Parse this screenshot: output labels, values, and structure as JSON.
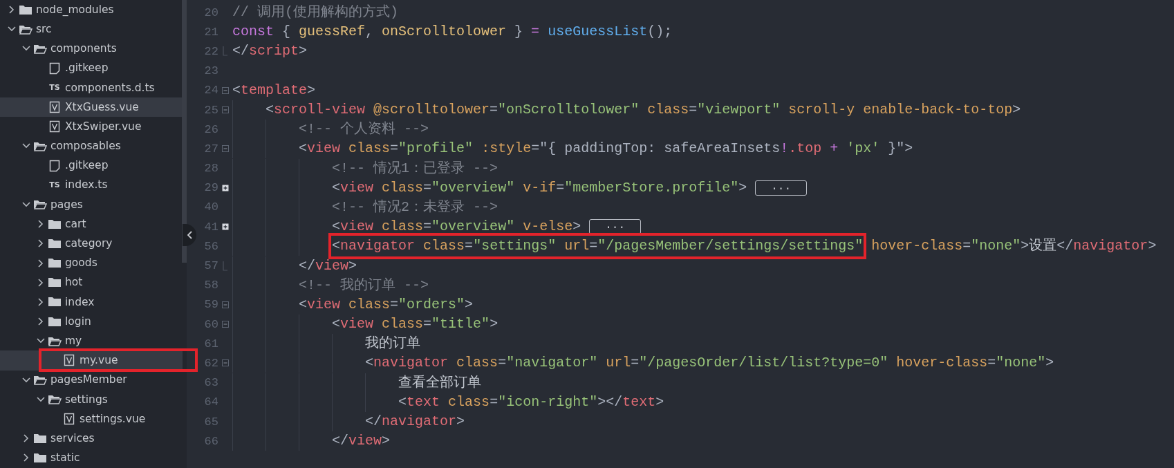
{
  "explorer": {
    "items": [
      {
        "kind": "folder",
        "name": "node_modules",
        "expanded": false,
        "selected": false
      },
      {
        "kind": "folder",
        "name": "src",
        "expanded": true,
        "selected": false,
        "children": [
          {
            "kind": "folder",
            "name": "components",
            "expanded": true,
            "selected": false,
            "children": [
              {
                "kind": "file",
                "name": ".gitkeep",
                "selected": false
              },
              {
                "kind": "ts",
                "badge": "TS",
                "name": "components.d.ts",
                "selected": false
              },
              {
                "kind": "vue",
                "name": "XtxGuess.vue",
                "selected": true
              },
              {
                "kind": "vue",
                "name": "XtxSwiper.vue",
                "selected": false
              }
            ]
          },
          {
            "kind": "folder",
            "name": "composables",
            "expanded": true,
            "selected": false,
            "children": [
              {
                "kind": "file",
                "name": ".gitkeep",
                "selected": false
              },
              {
                "kind": "ts",
                "badge": "TS",
                "name": "index.ts",
                "selected": false
              }
            ]
          },
          {
            "kind": "folder",
            "name": "pages",
            "expanded": true,
            "selected": false,
            "children": [
              {
                "kind": "folder",
                "name": "cart",
                "expanded": false,
                "selected": false
              },
              {
                "kind": "folder",
                "name": "category",
                "expanded": false,
                "selected": false
              },
              {
                "kind": "folder",
                "name": "goods",
                "expanded": false,
                "selected": false
              },
              {
                "kind": "folder",
                "name": "hot",
                "expanded": false,
                "selected": false
              },
              {
                "kind": "folder",
                "name": "index",
                "expanded": false,
                "selected": false
              },
              {
                "kind": "folder",
                "name": "login",
                "expanded": false,
                "selected": false
              },
              {
                "kind": "folder",
                "name": "my",
                "expanded": true,
                "selected": false,
                "children": [
                  {
                    "kind": "vue",
                    "name": "my.vue",
                    "selected": true,
                    "annotated": true
                  }
                ]
              }
            ]
          },
          {
            "kind": "folder",
            "name": "pagesMember",
            "expanded": true,
            "selected": false,
            "children": [
              {
                "kind": "folder",
                "name": "settings",
                "expanded": true,
                "selected": false,
                "children": [
                  {
                    "kind": "vue",
                    "name": "settings.vue",
                    "selected": false
                  }
                ]
              }
            ]
          },
          {
            "kind": "folder",
            "name": "services",
            "expanded": false,
            "selected": false
          },
          {
            "kind": "folder",
            "name": "static",
            "expanded": false,
            "selected": false
          }
        ]
      }
    ]
  },
  "editor": {
    "lines": [
      {
        "number": "20",
        "tokens": [
          {
            "kind": "com",
            "text": "// 调用(使用解构的方式)"
          }
        ]
      },
      {
        "number": "21",
        "tokens": [
          {
            "kind": "kw",
            "text": "const"
          },
          {
            "kind": "p",
            "text": " { "
          },
          {
            "kind": "var",
            "text": "guessRef"
          },
          {
            "kind": "p",
            "text": ", "
          },
          {
            "kind": "var",
            "text": "onScrolltolower"
          },
          {
            "kind": "p",
            "text": " } "
          },
          {
            "kind": "kw",
            "text": "="
          },
          {
            "kind": "fn",
            "text": " useGuessList"
          },
          {
            "kind": "p",
            "text": "();"
          }
        ]
      },
      {
        "number": "22",
        "fold_end": true,
        "tokens": [
          {
            "kind": "p",
            "text": "</"
          },
          {
            "kind": "tag",
            "text": "script"
          },
          {
            "kind": "p",
            "text": ">"
          }
        ]
      },
      {
        "number": "23"
      },
      {
        "number": "24",
        "collapsed": false,
        "tokens": [
          {
            "kind": "p",
            "text": "<"
          },
          {
            "kind": "tag",
            "text": "template"
          },
          {
            "kind": "p",
            "text": ">"
          }
        ]
      },
      {
        "number": "25",
        "collapsed": false,
        "tokens": [
          {
            "kind": "p",
            "text": "    <"
          },
          {
            "kind": "tag",
            "text": "scroll-view"
          },
          {
            "kind": "attr",
            "text": " @scrolltolower"
          },
          {
            "kind": "p",
            "text": "="
          },
          {
            "kind": "str",
            "text": "\"onScrolltolower\""
          },
          {
            "kind": "attr",
            "text": " class"
          },
          {
            "kind": "p",
            "text": "="
          },
          {
            "kind": "str",
            "text": "\"viewport\""
          },
          {
            "kind": "attr",
            "text": " scroll-y"
          },
          {
            "kind": "attr",
            "text": " enable-back-to-top"
          },
          {
            "kind": "p",
            "text": ">"
          }
        ]
      },
      {
        "number": "26",
        "tokens": [
          {
            "kind": "com",
            "text": "        <!-- 个人资料 -->"
          }
        ]
      },
      {
        "number": "27",
        "collapsed": false,
        "tokens": [
          {
            "kind": "p",
            "text": "        <"
          },
          {
            "kind": "tag",
            "text": "view"
          },
          {
            "kind": "attr",
            "text": " class"
          },
          {
            "kind": "p",
            "text": "="
          },
          {
            "kind": "str",
            "text": "\"profile\""
          },
          {
            "kind": "attr",
            "text": " :style"
          },
          {
            "kind": "p",
            "text": "=\"{ paddingTop: safeAreaInsets"
          },
          {
            "kind": "kw",
            "text": "!"
          },
          {
            "kind": "tag",
            "text": ".top"
          },
          {
            "kind": "kw",
            "text": " +"
          },
          {
            "kind": "str",
            "text": " 'px'"
          },
          {
            "kind": "p",
            "text": " }\">"
          }
        ]
      },
      {
        "number": "28",
        "tokens": [
          {
            "kind": "com",
            "text": "            <!-- 情况1：已登录 -->"
          }
        ]
      },
      {
        "number": "29",
        "collapsed": true,
        "fold_box": "...",
        "tokens": [
          {
            "kind": "p",
            "text": "            <"
          },
          {
            "kind": "tag",
            "text": "view"
          },
          {
            "kind": "attr",
            "text": " class"
          },
          {
            "kind": "p",
            "text": "="
          },
          {
            "kind": "str",
            "text": "\"overview\""
          },
          {
            "kind": "attr",
            "text": " v-if"
          },
          {
            "kind": "p",
            "text": "="
          },
          {
            "kind": "str",
            "text": "\"memberStore.profile\""
          },
          {
            "kind": "p",
            "text": ">"
          }
        ]
      },
      {
        "number": "40",
        "tokens": [
          {
            "kind": "com",
            "text": "            <!-- 情况2：未登录 -->"
          }
        ]
      },
      {
        "number": "41",
        "collapsed": true,
        "fold_box": "...",
        "tokens": [
          {
            "kind": "p",
            "text": "            <"
          },
          {
            "kind": "tag",
            "text": "view"
          },
          {
            "kind": "attr",
            "text": " class"
          },
          {
            "kind": "p",
            "text": "="
          },
          {
            "kind": "str",
            "text": "\"overview\""
          },
          {
            "kind": "attr",
            "text": " v-else"
          },
          {
            "kind": "p",
            "text": ">"
          }
        ]
      },
      {
        "number": "56",
        "framed": [
          {
            "kind": "p",
            "text": "            <"
          },
          {
            "kind": "tag",
            "text": "navigator"
          },
          {
            "kind": "attr",
            "text": " class"
          },
          {
            "kind": "p",
            "text": "="
          },
          {
            "kind": "str",
            "text": "\"settings\""
          },
          {
            "kind": "attr",
            "text": " url"
          },
          {
            "kind": "p",
            "text": "="
          },
          {
            "kind": "str",
            "text": "\"/pagesMember/settings/settings\""
          }
        ],
        "tokens": [
          {
            "kind": "attr",
            "text": " hover-class"
          },
          {
            "kind": "p",
            "text": "="
          },
          {
            "kind": "str",
            "text": "\"none\""
          },
          {
            "kind": "p",
            "text": ">"
          },
          {
            "kind": "txt",
            "text": "设置"
          },
          {
            "kind": "p",
            "text": "</"
          },
          {
            "kind": "tag",
            "text": "navigator"
          },
          {
            "kind": "p",
            "text": ">"
          }
        ]
      },
      {
        "number": "57",
        "fold_end": true,
        "tokens": [
          {
            "kind": "p",
            "text": "        </"
          },
          {
            "kind": "tag",
            "text": "view"
          },
          {
            "kind": "p",
            "text": ">"
          }
        ]
      },
      {
        "number": "58",
        "tokens": [
          {
            "kind": "com",
            "text": "        <!-- 我的订单 -->"
          }
        ]
      },
      {
        "number": "59",
        "collapsed": false,
        "tokens": [
          {
            "kind": "p",
            "text": "        <"
          },
          {
            "kind": "tag",
            "text": "view"
          },
          {
            "kind": "attr",
            "text": " class"
          },
          {
            "kind": "p",
            "text": "="
          },
          {
            "kind": "str",
            "text": "\"orders\""
          },
          {
            "kind": "p",
            "text": ">"
          }
        ]
      },
      {
        "number": "60",
        "collapsed": false,
        "tokens": [
          {
            "kind": "p",
            "text": "            <"
          },
          {
            "kind": "tag",
            "text": "view"
          },
          {
            "kind": "attr",
            "text": " class"
          },
          {
            "kind": "p",
            "text": "="
          },
          {
            "kind": "str",
            "text": "\"title\""
          },
          {
            "kind": "p",
            "text": ">"
          }
        ]
      },
      {
        "number": "61",
        "tokens": [
          {
            "kind": "txt",
            "text": "                我的订单"
          }
        ]
      },
      {
        "number": "62",
        "collapsed": false,
        "tokens": [
          {
            "kind": "p",
            "text": "                <"
          },
          {
            "kind": "tag",
            "text": "navigator"
          },
          {
            "kind": "attr",
            "text": " class"
          },
          {
            "kind": "p",
            "text": "="
          },
          {
            "kind": "str",
            "text": "\"navigator\""
          },
          {
            "kind": "attr",
            "text": " url"
          },
          {
            "kind": "p",
            "text": "="
          },
          {
            "kind": "str",
            "text": "\"/pagesOrder/list/list?type=0\""
          },
          {
            "kind": "attr",
            "text": " hover-class"
          },
          {
            "kind": "p",
            "text": "="
          },
          {
            "kind": "str",
            "text": "\"none\""
          },
          {
            "kind": "p",
            "text": ">"
          }
        ]
      },
      {
        "number": "63",
        "tokens": [
          {
            "kind": "txt",
            "text": "                    查看全部订单"
          }
        ]
      },
      {
        "number": "64",
        "tokens": [
          {
            "kind": "p",
            "text": "                    <"
          },
          {
            "kind": "tag",
            "text": "text"
          },
          {
            "kind": "attr",
            "text": " class"
          },
          {
            "kind": "p",
            "text": "="
          },
          {
            "kind": "str",
            "text": "\"icon-right\""
          },
          {
            "kind": "p",
            "text": "></"
          },
          {
            "kind": "tag",
            "text": "text"
          },
          {
            "kind": "p",
            "text": ">"
          }
        ]
      },
      {
        "number": "65",
        "tokens": [
          {
            "kind": "p",
            "text": "                </"
          },
          {
            "kind": "tag",
            "text": "navigator"
          },
          {
            "kind": "p",
            "text": ">"
          }
        ]
      },
      {
        "number": "66",
        "tokens": [
          {
            "kind": "p",
            "text": "            </"
          },
          {
            "kind": "tag",
            "text": "view"
          },
          {
            "kind": "p",
            "text": ">"
          }
        ]
      }
    ]
  }
}
